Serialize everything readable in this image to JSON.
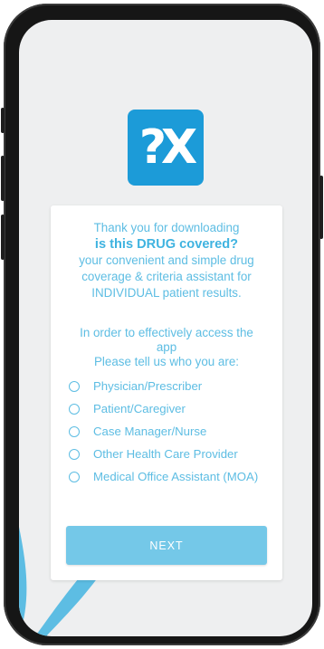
{
  "logo": {
    "text": "?X"
  },
  "intro": {
    "line1": "Thank you for downloading",
    "title": "is this DRUG covered?",
    "line3": "your convenient and simple drug",
    "line4": "coverage & criteria assistant for",
    "line5": "INDIVIDUAL patient results."
  },
  "prompt": {
    "line1": "In order to effectively access the",
    "line2": "app",
    "line3": "Please tell us who you are:"
  },
  "options": [
    {
      "label": "Physician/Prescriber",
      "selected": false
    },
    {
      "label": "Patient/Caregiver",
      "selected": false
    },
    {
      "label": "Case Manager/Nurse",
      "selected": false
    },
    {
      "label": "Other Health Care Provider",
      "selected": false
    },
    {
      "label": "Medical Office Assistant (MOA)",
      "selected": false
    }
  ],
  "next_button": {
    "label": "NEXT"
  },
  "colors": {
    "accent": "#5dbde3",
    "logo_bg": "#1c9bd8",
    "button_bg": "#74c8e8",
    "screen_bg": "#eeeff0"
  }
}
